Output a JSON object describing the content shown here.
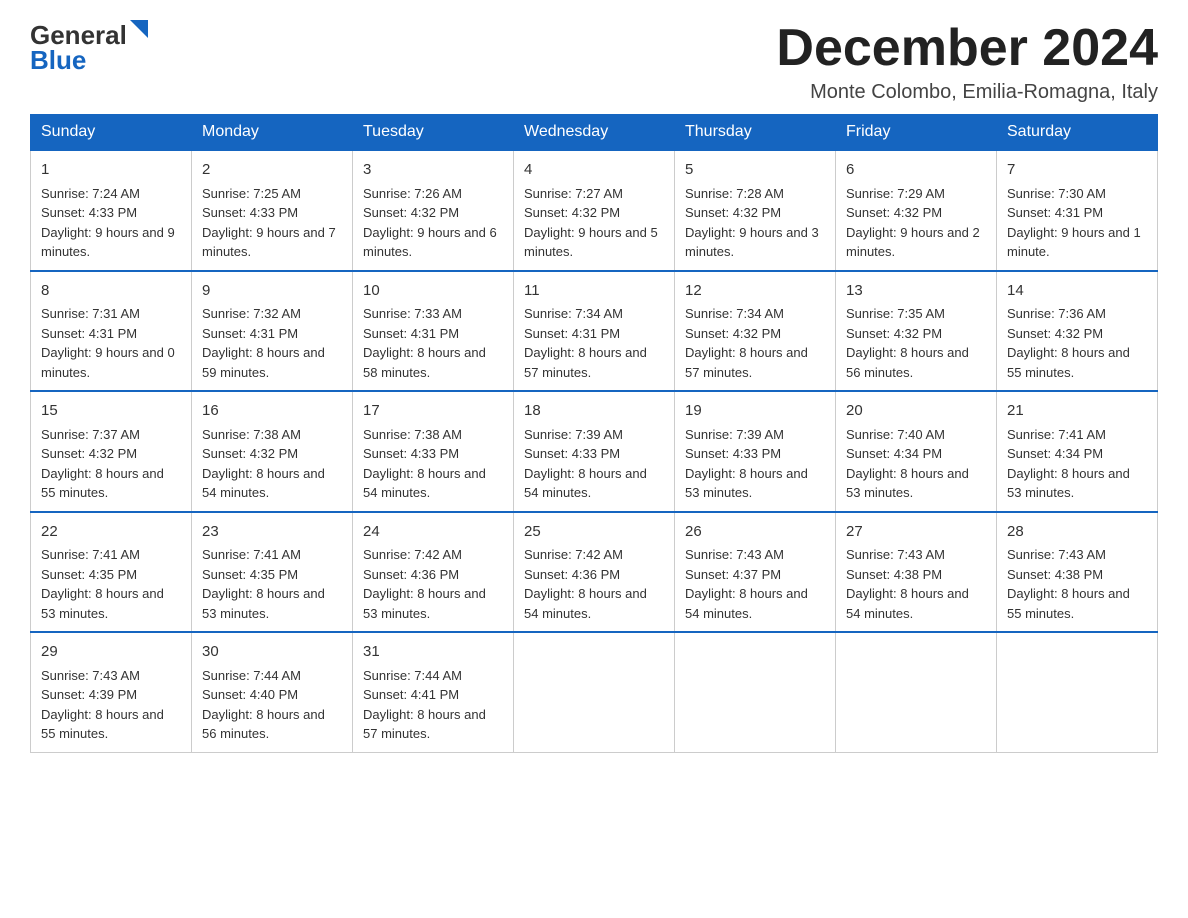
{
  "header": {
    "logo_text1": "General",
    "logo_text2": "Blue",
    "month_title": "December 2024",
    "location": "Monte Colombo, Emilia-Romagna, Italy"
  },
  "days_of_week": [
    "Sunday",
    "Monday",
    "Tuesday",
    "Wednesday",
    "Thursday",
    "Friday",
    "Saturday"
  ],
  "weeks": [
    [
      {
        "day": "1",
        "sunrise": "7:24 AM",
        "sunset": "4:33 PM",
        "daylight": "9 hours and 9 minutes."
      },
      {
        "day": "2",
        "sunrise": "7:25 AM",
        "sunset": "4:33 PM",
        "daylight": "9 hours and 7 minutes."
      },
      {
        "day": "3",
        "sunrise": "7:26 AM",
        "sunset": "4:32 PM",
        "daylight": "9 hours and 6 minutes."
      },
      {
        "day": "4",
        "sunrise": "7:27 AM",
        "sunset": "4:32 PM",
        "daylight": "9 hours and 5 minutes."
      },
      {
        "day": "5",
        "sunrise": "7:28 AM",
        "sunset": "4:32 PM",
        "daylight": "9 hours and 3 minutes."
      },
      {
        "day": "6",
        "sunrise": "7:29 AM",
        "sunset": "4:32 PM",
        "daylight": "9 hours and 2 minutes."
      },
      {
        "day": "7",
        "sunrise": "7:30 AM",
        "sunset": "4:31 PM",
        "daylight": "9 hours and 1 minute."
      }
    ],
    [
      {
        "day": "8",
        "sunrise": "7:31 AM",
        "sunset": "4:31 PM",
        "daylight": "9 hours and 0 minutes."
      },
      {
        "day": "9",
        "sunrise": "7:32 AM",
        "sunset": "4:31 PM",
        "daylight": "8 hours and 59 minutes."
      },
      {
        "day": "10",
        "sunrise": "7:33 AM",
        "sunset": "4:31 PM",
        "daylight": "8 hours and 58 minutes."
      },
      {
        "day": "11",
        "sunrise": "7:34 AM",
        "sunset": "4:31 PM",
        "daylight": "8 hours and 57 minutes."
      },
      {
        "day": "12",
        "sunrise": "7:34 AM",
        "sunset": "4:32 PM",
        "daylight": "8 hours and 57 minutes."
      },
      {
        "day": "13",
        "sunrise": "7:35 AM",
        "sunset": "4:32 PM",
        "daylight": "8 hours and 56 minutes."
      },
      {
        "day": "14",
        "sunrise": "7:36 AM",
        "sunset": "4:32 PM",
        "daylight": "8 hours and 55 minutes."
      }
    ],
    [
      {
        "day": "15",
        "sunrise": "7:37 AM",
        "sunset": "4:32 PM",
        "daylight": "8 hours and 55 minutes."
      },
      {
        "day": "16",
        "sunrise": "7:38 AM",
        "sunset": "4:32 PM",
        "daylight": "8 hours and 54 minutes."
      },
      {
        "day": "17",
        "sunrise": "7:38 AM",
        "sunset": "4:33 PM",
        "daylight": "8 hours and 54 minutes."
      },
      {
        "day": "18",
        "sunrise": "7:39 AM",
        "sunset": "4:33 PM",
        "daylight": "8 hours and 54 minutes."
      },
      {
        "day": "19",
        "sunrise": "7:39 AM",
        "sunset": "4:33 PM",
        "daylight": "8 hours and 53 minutes."
      },
      {
        "day": "20",
        "sunrise": "7:40 AM",
        "sunset": "4:34 PM",
        "daylight": "8 hours and 53 minutes."
      },
      {
        "day": "21",
        "sunrise": "7:41 AM",
        "sunset": "4:34 PM",
        "daylight": "8 hours and 53 minutes."
      }
    ],
    [
      {
        "day": "22",
        "sunrise": "7:41 AM",
        "sunset": "4:35 PM",
        "daylight": "8 hours and 53 minutes."
      },
      {
        "day": "23",
        "sunrise": "7:41 AM",
        "sunset": "4:35 PM",
        "daylight": "8 hours and 53 minutes."
      },
      {
        "day": "24",
        "sunrise": "7:42 AM",
        "sunset": "4:36 PM",
        "daylight": "8 hours and 53 minutes."
      },
      {
        "day": "25",
        "sunrise": "7:42 AM",
        "sunset": "4:36 PM",
        "daylight": "8 hours and 54 minutes."
      },
      {
        "day": "26",
        "sunrise": "7:43 AM",
        "sunset": "4:37 PM",
        "daylight": "8 hours and 54 minutes."
      },
      {
        "day": "27",
        "sunrise": "7:43 AM",
        "sunset": "4:38 PM",
        "daylight": "8 hours and 54 minutes."
      },
      {
        "day": "28",
        "sunrise": "7:43 AM",
        "sunset": "4:38 PM",
        "daylight": "8 hours and 55 minutes."
      }
    ],
    [
      {
        "day": "29",
        "sunrise": "7:43 AM",
        "sunset": "4:39 PM",
        "daylight": "8 hours and 55 minutes."
      },
      {
        "day": "30",
        "sunrise": "7:44 AM",
        "sunset": "4:40 PM",
        "daylight": "8 hours and 56 minutes."
      },
      {
        "day": "31",
        "sunrise": "7:44 AM",
        "sunset": "4:41 PM",
        "daylight": "8 hours and 57 minutes."
      },
      null,
      null,
      null,
      null
    ]
  ]
}
